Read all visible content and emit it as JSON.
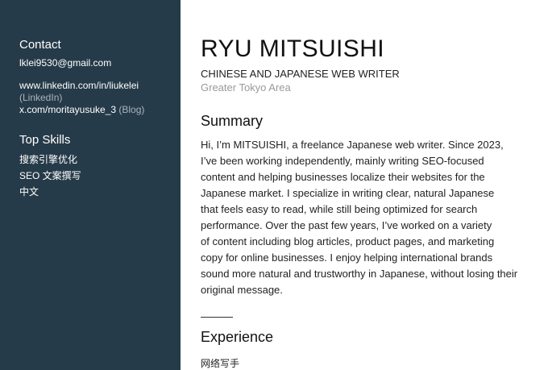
{
  "sidebar": {
    "contact": {
      "heading": "Contact",
      "email": "lklei9530@gmail.com",
      "linkedin_url": "www.linkedin.com/in/liukelei",
      "linkedin_note": "(LinkedIn)",
      "blog_url": "x.com/moritayusuke_3",
      "blog_note": "(Blog)"
    },
    "skills": {
      "heading": "Top Skills",
      "items": [
        "搜索引擎优化",
        "SEO 文案撰写",
        "中文"
      ]
    }
  },
  "main": {
    "name": "RYU MITSUISHI",
    "role": "CHINESE AND JAPANESE WEB WRITER",
    "location": "Greater Tokyo Area",
    "summary": {
      "title": "Summary",
      "lines": [
        "Hi, I’m  MITSUISHI, a freelance Japanese web writer. Since 2023,",
        "I’ve been working independently, mainly writing SEO-focused",
        "content and helping businesses localize their websites for the",
        "Japanese market. I specialize in writing clear, natural Japanese",
        "that feels easy to read, while still being optimized for search",
        "performance. Over the past few years, I’ve worked on a variety",
        "of content including blog articles, product pages, and marketing",
        "copy for online businesses. I enjoy helping international brands",
        "sound more natural and trustworthy in Japanese, without losing their",
        "original message."
      ]
    },
    "experience": {
      "title": "Experience",
      "first_item": "网络写手"
    }
  }
}
